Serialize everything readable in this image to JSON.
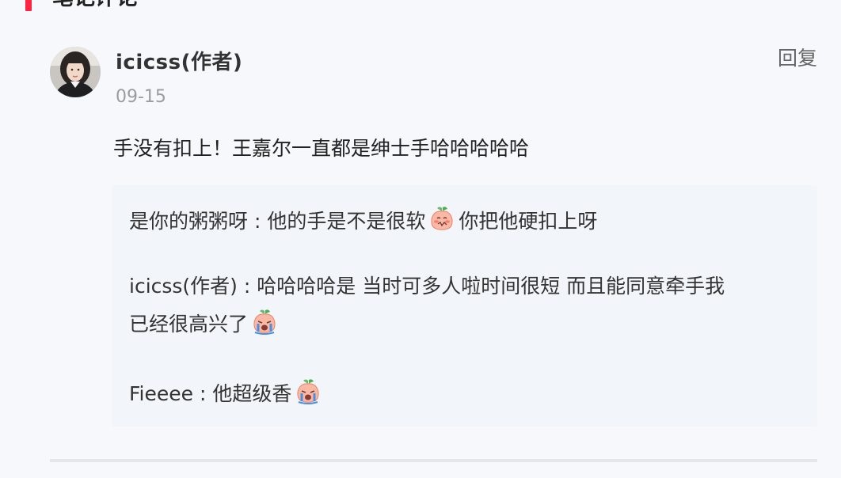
{
  "section": {
    "title": "笔记评论"
  },
  "comment": {
    "author": "icicss(作者)",
    "date": "09-15",
    "reply_label": "回复",
    "text": "手没有扣上！王嘉尔一直都是绅士手哈哈哈哈哈"
  },
  "replies": [
    {
      "text_before": "是你的粥粥呀 : 他的手是不是很软",
      "emoji": "peach-shy-emoji",
      "text_after": "你把他硬扣上呀"
    },
    {
      "text_line1": "icicss(作者) : 哈哈哈哈是 当时可多人啦时间很短 而且能同意牵手我",
      "text_line2": "已经很高兴了",
      "emoji": "peach-crying-emoji"
    },
    {
      "text_before": "Fieeee : 他超级香",
      "emoji": "peach-crying-emoji"
    }
  ],
  "colors": {
    "accent": "#ff2442",
    "reply_bg": "#f2f5f9",
    "meta": "#9c9c9c"
  }
}
